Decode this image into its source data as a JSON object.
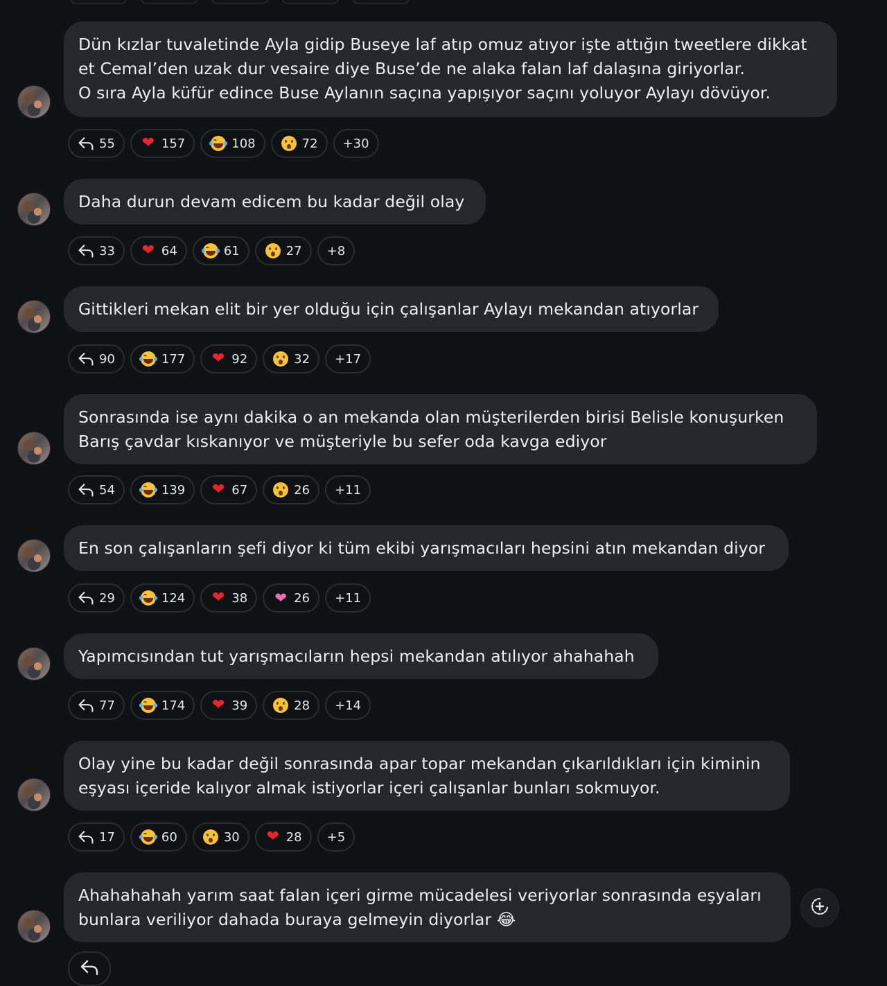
{
  "messages": [
    {
      "text": "Dün kızlar tuvaletinde Ayla gidip Buseye laf atıp omuz atıyor işte attığın tweetlere dikkat\net Cemal’den uzak dur vesaire diye Buse’de ne alaka falan laf dalaşına giriyorlar.\nO sıra Ayla küfür edince Buse Aylanın saçına yapışıyor saçını yoluyor Aylayı dövüyor.",
      "replies": "55",
      "reactions": [
        {
          "emoji": "heart",
          "count": "157"
        },
        {
          "emoji": "laugh",
          "count": "108"
        },
        {
          "emoji": "wow",
          "count": "72"
        }
      ],
      "more": "+30"
    },
    {
      "text": "Daha durun devam edicem bu kadar değil olay",
      "replies": "33",
      "reactions": [
        {
          "emoji": "heart",
          "count": "64"
        },
        {
          "emoji": "laugh",
          "count": "61"
        },
        {
          "emoji": "wow",
          "count": "27"
        }
      ],
      "more": "+8"
    },
    {
      "text": "Gittikleri mekan elit bir yer olduğu için çalışanlar Aylayı mekandan atıyorlar",
      "replies": "90",
      "reactions": [
        {
          "emoji": "laugh",
          "count": "177"
        },
        {
          "emoji": "heart",
          "count": "92"
        },
        {
          "emoji": "wow",
          "count": "32"
        }
      ],
      "more": "+17"
    },
    {
      "text": "Sonrasında ise aynı dakika o an mekanda olan müşterilerden birisi Belisle konuşurken\nBarış çavdar kıskanıyor ve müşteriyle bu sefer oda kavga ediyor",
      "replies": "54",
      "reactions": [
        {
          "emoji": "laugh",
          "count": "139"
        },
        {
          "emoji": "heart",
          "count": "67"
        },
        {
          "emoji": "wow",
          "count": "26"
        }
      ],
      "more": "+11"
    },
    {
      "text": "En son çalışanların şefi diyor ki tüm ekibi yarışmacıları hepsini atın mekandan diyor",
      "replies": "29",
      "reactions": [
        {
          "emoji": "laugh",
          "count": "124"
        },
        {
          "emoji": "heart",
          "count": "38"
        },
        {
          "emoji": "pinkheart",
          "count": "26"
        }
      ],
      "more": "+11"
    },
    {
      "text": "Yapımcısından tut yarışmacıların hepsi mekandan atılıyor ahahahah",
      "replies": "77",
      "reactions": [
        {
          "emoji": "laugh",
          "count": "174"
        },
        {
          "emoji": "heart",
          "count": "39"
        },
        {
          "emoji": "wow",
          "count": "28"
        }
      ],
      "more": "+14"
    },
    {
      "text": "Olay yine bu kadar değil sonrasında apar topar mekandan çıkarıldıkları için kiminin\neşyası içeride kalıyor almak istiyorlar içeri çalışanlar bunları sokmuyor.",
      "replies": "17",
      "reactions": [
        {
          "emoji": "laugh",
          "count": "60"
        },
        {
          "emoji": "wow",
          "count": "30"
        },
        {
          "emoji": "heart",
          "count": "28"
        }
      ],
      "more": "+5"
    },
    {
      "text": "Ahahahahah yarım saat falan içeri girme mücadelesi veriyorlar sonrasında eşyaları\nbunlara veriliyor dahada buraya gelmeyin diyorlar 😂",
      "replies": "",
      "reactions": [],
      "more": ""
    }
  ],
  "colors": {
    "background": "#101115",
    "bubble": "#26272d",
    "chip_border": "#2a2b31",
    "heart": "#e8252f"
  },
  "icons": {
    "reply": "reply-arrow-icon",
    "add_reaction": "add-reaction-icon"
  }
}
